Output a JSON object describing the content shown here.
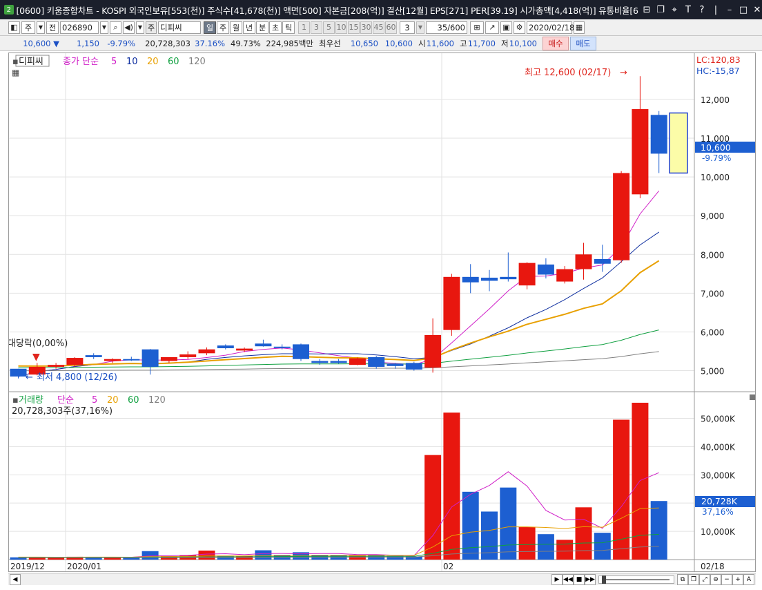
{
  "titlebar": {
    "window_number": "2",
    "title": "[0600] 키움종합차트 - KOSPI 외국인보유[553(천)] 주식수[41,678(천)] 액면[500] 자본금[208(억)] 결산[12월] EPS[271] PER[39.19] 시가총액[4,418(억)] 유통비율[6"
  },
  "toolbar": {
    "period_selector": "주",
    "prev_label": "전",
    "stock_code": "026890",
    "stock_type": "주",
    "stock_name": "디피씨",
    "timeframes": [
      "일",
      "주",
      "월",
      "년",
      "분",
      "초",
      "틱"
    ],
    "selected_timeframe": "일",
    "minute_steps": [
      "1",
      "3",
      "5",
      "10",
      "15",
      "30",
      "45",
      "60"
    ],
    "custom_step": "3",
    "count": "35",
    "count_max": "/600",
    "date": "2020/02/18"
  },
  "infobar": {
    "price": "10,600",
    "change": "1,150",
    "change_pct": "-9.79%",
    "volume": "20,728,303",
    "volume_pct": "37.16%",
    "turnover_pct": "49.73%",
    "amount": "224,985백만",
    "best_bid_label": "최우선",
    "best_bid": "10,650",
    "best_ask": "10,600",
    "open_label": "시",
    "open": "11,600",
    "high_label": "고",
    "high": "11,700",
    "low_label": "저",
    "low": "10,100",
    "buy_label": "매수",
    "sell_label": "매도"
  },
  "price_panel": {
    "stock_tag": "디피씨",
    "legend_prefix": "종가 단순",
    "ma_periods": [
      "5",
      "10",
      "20",
      "60",
      "120"
    ],
    "ma_colors": [
      "#d020c8",
      "#1030a0",
      "#e8a000",
      "#10a040",
      "#808080"
    ],
    "lc_label": "LC:120,83",
    "hc_label": "HC:-15,87",
    "high_annotation": "최고 12,600 (02/17)",
    "low_annotation": "최저 4,800 (12/26)",
    "left_annotation": "대당락(0,00%)",
    "current_price_tag": "10,600",
    "current_change_tag": "-9.79%",
    "y_ticks": [
      "12,000",
      "11,000",
      "10,000",
      "9,000",
      "8,000",
      "7,000",
      "6,000",
      "5,000"
    ]
  },
  "volume_panel": {
    "legend_prefix": "거래량",
    "legend_ma": "단순",
    "ma_periods": [
      "5",
      "20",
      "60",
      "120"
    ],
    "summary": "20,728,303주(37,16%)",
    "current_volume_tag": "20,728K",
    "current_volume_pct": "37,16%",
    "y_ticks": [
      "50,000K",
      "40,000K",
      "30,000K",
      "20,000K",
      "10,000K"
    ]
  },
  "x_axis": {
    "labels": [
      "2019/12",
      "2020/01",
      "02",
      "02/18"
    ]
  },
  "colors": {
    "up": "#e8170f",
    "down": "#1d5fd1",
    "titlebar_bg": "#1b1f2b"
  },
  "chart_data": {
    "type": "candlestick",
    "price_range": [
      4600,
      12800
    ],
    "volume_range": [
      0,
      55000000
    ],
    "candles": [
      {
        "o": 5050,
        "h": 5050,
        "l": 4800,
        "c": 4850
      },
      {
        "o": 4900,
        "h": 5200,
        "l": 4880,
        "c": 5100
      },
      {
        "o": 5100,
        "h": 5200,
        "l": 5050,
        "c": 5150
      },
      {
        "o": 5150,
        "h": 5350,
        "l": 5100,
        "c": 5330
      },
      {
        "o": 5400,
        "h": 5450,
        "l": 5300,
        "c": 5350
      },
      {
        "o": 5250,
        "h": 5320,
        "l": 5200,
        "c": 5300
      },
      {
        "o": 5300,
        "h": 5360,
        "l": 5250,
        "c": 5280
      },
      {
        "o": 5550,
        "h": 5560,
        "l": 4900,
        "c": 5100
      },
      {
        "o": 5250,
        "h": 5350,
        "l": 5200,
        "c": 5350
      },
      {
        "o": 5350,
        "h": 5500,
        "l": 5300,
        "c": 5420
      },
      {
        "o": 5450,
        "h": 5600,
        "l": 5400,
        "c": 5550
      },
      {
        "o": 5650,
        "h": 5680,
        "l": 5550,
        "c": 5580
      },
      {
        "o": 5520,
        "h": 5600,
        "l": 5480,
        "c": 5570
      },
      {
        "o": 5700,
        "h": 5800,
        "l": 5620,
        "c": 5630
      },
      {
        "o": 5620,
        "h": 5680,
        "l": 5550,
        "c": 5600
      },
      {
        "o": 5680,
        "h": 5700,
        "l": 5250,
        "c": 5300
      },
      {
        "o": 5250,
        "h": 5300,
        "l": 5150,
        "c": 5200
      },
      {
        "o": 5250,
        "h": 5300,
        "l": 5180,
        "c": 5200
      },
      {
        "o": 5150,
        "h": 5340,
        "l": 5140,
        "c": 5320
      },
      {
        "o": 5350,
        "h": 5380,
        "l": 5050,
        "c": 5100
      },
      {
        "o": 5180,
        "h": 5200,
        "l": 5050,
        "c": 5120
      },
      {
        "o": 5200,
        "h": 5230,
        "l": 5000,
        "c": 5030
      },
      {
        "o": 5080,
        "h": 6350,
        "l": 4950,
        "c": 5920
      },
      {
        "o": 6050,
        "h": 7500,
        "l": 5900,
        "c": 7420
      },
      {
        "o": 7420,
        "h": 7750,
        "l": 7000,
        "c": 7280
      },
      {
        "o": 7400,
        "h": 7600,
        "l": 7050,
        "c": 7320
      },
      {
        "o": 7420,
        "h": 8050,
        "l": 7300,
        "c": 7360
      },
      {
        "o": 7200,
        "h": 7800,
        "l": 7100,
        "c": 7780
      },
      {
        "o": 7740,
        "h": 7900,
        "l": 7380,
        "c": 7480
      },
      {
        "o": 7300,
        "h": 7700,
        "l": 7250,
        "c": 7620
      },
      {
        "o": 7620,
        "h": 8300,
        "l": 7350,
        "c": 8000
      },
      {
        "o": 7880,
        "h": 8250,
        "l": 7550,
        "c": 7760
      },
      {
        "o": 7850,
        "h": 10150,
        "l": 7780,
        "c": 10100
      },
      {
        "o": 9550,
        "h": 12600,
        "l": 9450,
        "c": 11750
      },
      {
        "o": 11600,
        "h": 11700,
        "l": 10100,
        "c": 10600
      }
    ],
    "volumes": [
      800000,
      700000,
      600000,
      1000000,
      900000,
      900000,
      800000,
      3000000,
      1200000,
      1600000,
      3200000,
      1400000,
      1300000,
      3300000,
      1700000,
      2600000,
      1700000,
      1500000,
      1400000,
      1700000,
      1300000,
      1100000,
      37000000,
      52000000,
      24000000,
      17000000,
      25500000,
      11500000,
      9000000,
      7000000,
      18500000,
      9500000,
      49500000,
      55500000,
      20728303
    ]
  }
}
